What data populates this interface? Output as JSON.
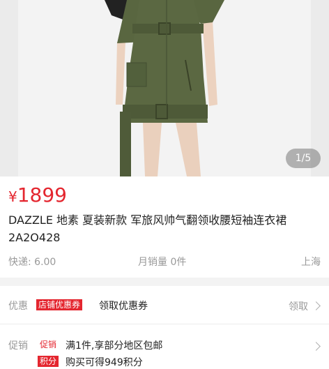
{
  "gallery": {
    "counter": "1/5"
  },
  "product": {
    "currency": "¥",
    "price": "1899",
    "title": "DAZZLE 地素 夏装新款 军旅风帅气翻领收腰短袖连衣裙 2A2O428",
    "shipping": "快递: 6.00",
    "monthly_sales": "月销量 0件",
    "location": "上海"
  },
  "coupon": {
    "label": "优惠",
    "tag": "店铺优惠券",
    "text": "领取优惠券",
    "action": "领取"
  },
  "promotion": {
    "label": "促销",
    "items": [
      {
        "tag": "促销",
        "text": "满1件,享部分地区包邮"
      },
      {
        "tag": "积分",
        "text": "购买可得949积分"
      }
    ]
  },
  "colors": {
    "accent": "#e4262f",
    "dress": "#5b6842"
  }
}
